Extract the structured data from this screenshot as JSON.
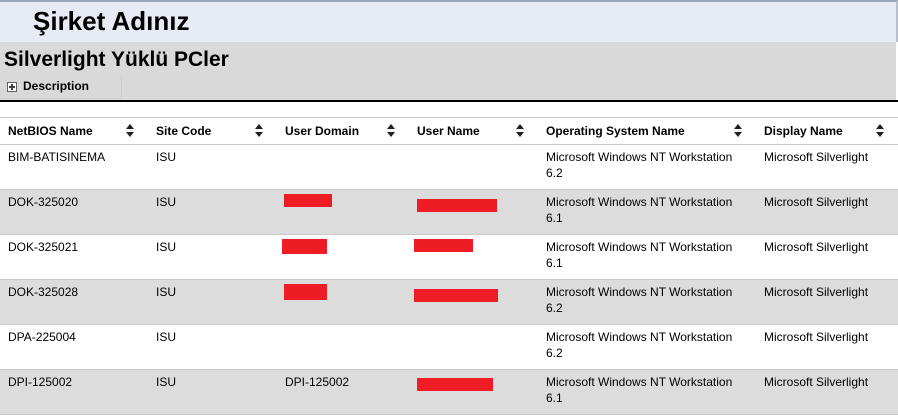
{
  "header": {
    "company_name": "Şirket Adınız"
  },
  "report": {
    "title": "Silverlight Yüklü PCler",
    "description_label": "Description"
  },
  "table": {
    "columns": [
      {
        "label": "NetBIOS Name"
      },
      {
        "label": "Site Code"
      },
      {
        "label": "User Domain"
      },
      {
        "label": "User Name"
      },
      {
        "label": "Operating System Name"
      },
      {
        "label": "Display Name"
      }
    ],
    "rows": [
      {
        "netbios": "BIM-BATISINEMA",
        "site": "ISU",
        "domain": "",
        "user": "",
        "os": "Microsoft Windows NT Workstation 6.2",
        "display": "Microsoft Silverlight"
      },
      {
        "netbios": "DOK-325020",
        "site": "ISU",
        "domain": "",
        "user": "",
        "os": "Microsoft Windows NT Workstation 6.1",
        "display": "Microsoft Silverlight"
      },
      {
        "netbios": "DOK-325021",
        "site": "ISU",
        "domain": "",
        "user": "",
        "os": "Microsoft Windows NT Workstation 6.1",
        "display": "Microsoft Silverlight"
      },
      {
        "netbios": "DOK-325028",
        "site": "ISU",
        "domain": "",
        "user": "",
        "os": "Microsoft Windows NT Workstation 6.2",
        "display": "Microsoft Silverlight"
      },
      {
        "netbios": "DPA-225004",
        "site": "ISU",
        "domain": "",
        "user": "",
        "os": "Microsoft Windows NT Workstation 6.2",
        "display": "Microsoft Silverlight"
      },
      {
        "netbios": "DPI-125002",
        "site": "ISU",
        "domain": "DPI-125002",
        "user": "",
        "os": "Microsoft Windows NT Workstation 6.1",
        "display": "Microsoft Silverlight"
      }
    ]
  },
  "colors": {
    "redaction": "#ee1c25",
    "alt_row": "#dcdcdc",
    "company_bar": "#e6ebf5",
    "report_bg": "#d9d9d9"
  }
}
